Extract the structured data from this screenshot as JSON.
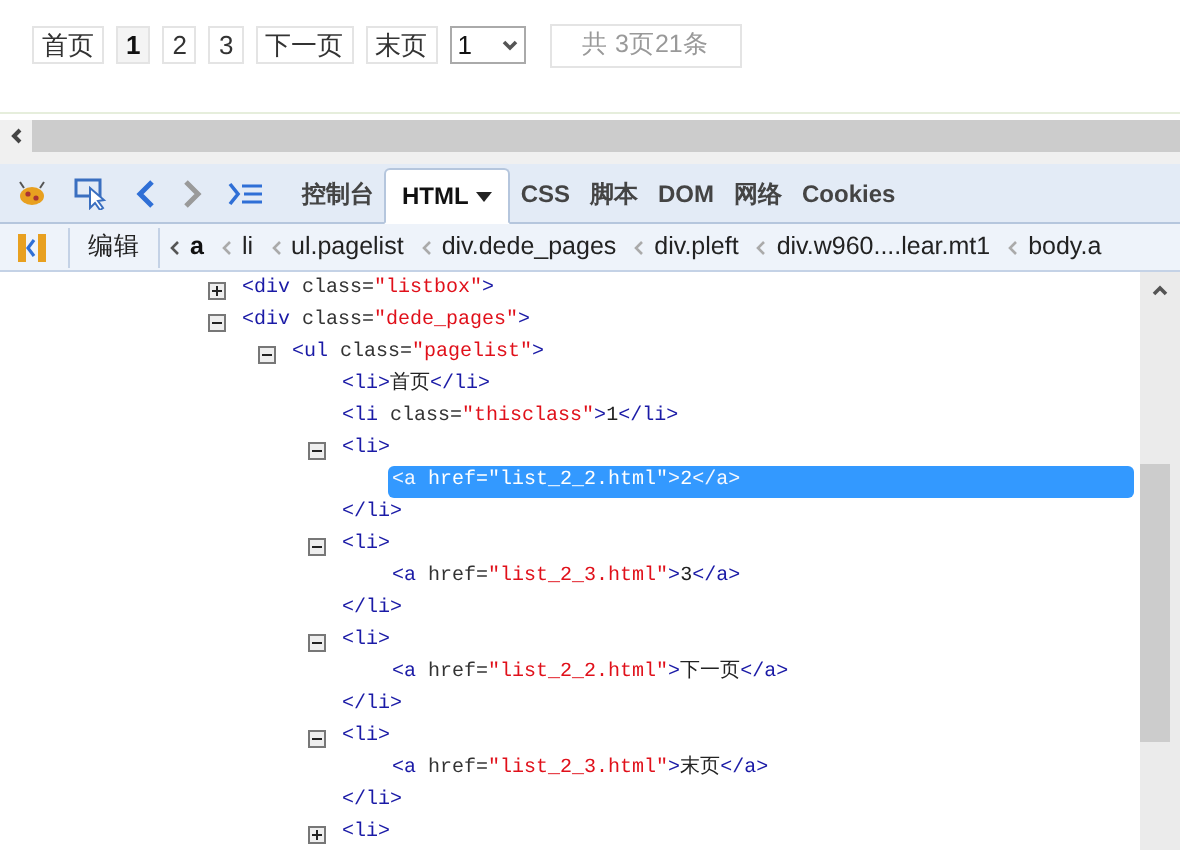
{
  "pagination": {
    "items": [
      {
        "text": "首页",
        "selected": false
      },
      {
        "text": "1",
        "selected": true
      },
      {
        "text": "2",
        "selected": false
      },
      {
        "text": "3",
        "selected": false
      },
      {
        "text": "下一页",
        "selected": false
      },
      {
        "text": "末页",
        "selected": false
      }
    ],
    "page_select": {
      "value": "1"
    },
    "summary": "共 3页21条"
  },
  "devtools": {
    "tabs": [
      {
        "label": "控制台",
        "selected": false,
        "dropdown": false
      },
      {
        "label": "HTML",
        "selected": true,
        "dropdown": true
      },
      {
        "label": "CSS",
        "selected": false,
        "dropdown": false
      },
      {
        "label": "脚本",
        "selected": false,
        "dropdown": false
      },
      {
        "label": "DOM",
        "selected": false,
        "dropdown": false
      },
      {
        "label": "网络",
        "selected": false,
        "dropdown": false
      },
      {
        "label": "Cookies",
        "selected": false,
        "dropdown": false
      }
    ],
    "edit_button": "编辑",
    "breadcrumbs": [
      {
        "label": "a",
        "selected": true
      },
      {
        "label": "li",
        "selected": false
      },
      {
        "label": "ul.pagelist",
        "selected": false
      },
      {
        "label": "div.dede_pages",
        "selected": false
      },
      {
        "label": "div.pleft",
        "selected": false
      },
      {
        "label": "div.w960....lear.mt1",
        "selected": false
      },
      {
        "label": "body.a",
        "selected": false
      }
    ],
    "tree": [
      {
        "selected": false,
        "expanded": false,
        "line": [
          {
            "kind": "tag",
            "text": "<div"
          },
          {
            "kind": "attr",
            "text": " class="
          },
          {
            "kind": "value",
            "text": "\"listbox\""
          },
          {
            "kind": "tag",
            "text": ">"
          }
        ]
      },
      {
        "selected": false,
        "expanded": true,
        "line": [
          {
            "kind": "tag",
            "text": "<div"
          },
          {
            "kind": "attr",
            "text": " class="
          },
          {
            "kind": "value",
            "text": "\"dede_pages\""
          },
          {
            "kind": "tag",
            "text": ">"
          }
        ],
        "children": [
          {
            "selected": false,
            "expanded": true,
            "line": [
              {
                "kind": "tag",
                "text": "<ul"
              },
              {
                "kind": "attr",
                "text": " class="
              },
              {
                "kind": "value",
                "text": "\"pagelist\""
              },
              {
                "kind": "tag",
                "text": ">"
              }
            ],
            "children": [
              {
                "selected": false,
                "line": [
                  {
                    "kind": "tag",
                    "text": "<li>"
                  },
                  {
                    "kind": "text",
                    "text": "首页"
                  },
                  {
                    "kind": "tag",
                    "text": "</li>"
                  }
                ]
              },
              {
                "selected": false,
                "line": [
                  {
                    "kind": "tag",
                    "text": "<li"
                  },
                  {
                    "kind": "attr",
                    "text": " class="
                  },
                  {
                    "kind": "value",
                    "text": "\"thisclass\""
                  },
                  {
                    "kind": "tag",
                    "text": ">"
                  },
                  {
                    "kind": "text",
                    "text": "1"
                  },
                  {
                    "kind": "tag",
                    "text": "</li>"
                  }
                ]
              },
              {
                "selected": false,
                "expanded": true,
                "line": [
                  {
                    "kind": "tag",
                    "text": "<li>"
                  }
                ],
                "close": [
                  {
                    "kind": "tag",
                    "text": "</li>"
                  }
                ],
                "children": [
                  {
                    "selected": true,
                    "line": [
                      {
                        "kind": "tag",
                        "text": "<a"
                      },
                      {
                        "kind": "attr",
                        "text": " href="
                      },
                      {
                        "kind": "value",
                        "text": "\"list_2_2.html\""
                      },
                      {
                        "kind": "tag",
                        "text": ">"
                      },
                      {
                        "kind": "text",
                        "text": "2"
                      },
                      {
                        "kind": "tag",
                        "text": "</a>"
                      }
                    ]
                  }
                ]
              },
              {
                "selected": false,
                "expanded": true,
                "line": [
                  {
                    "kind": "tag",
                    "text": "<li>"
                  }
                ],
                "close": [
                  {
                    "kind": "tag",
                    "text": "</li>"
                  }
                ],
                "children": [
                  {
                    "selected": false,
                    "line": [
                      {
                        "kind": "tag",
                        "text": "<a"
                      },
                      {
                        "kind": "attr",
                        "text": " href="
                      },
                      {
                        "kind": "value",
                        "text": "\"list_2_3.html\""
                      },
                      {
                        "kind": "tag",
                        "text": ">"
                      },
                      {
                        "kind": "text",
                        "text": "3"
                      },
                      {
                        "kind": "tag",
                        "text": "</a>"
                      }
                    ]
                  }
                ]
              },
              {
                "selected": false,
                "expanded": true,
                "line": [
                  {
                    "kind": "tag",
                    "text": "<li>"
                  }
                ],
                "close": [
                  {
                    "kind": "tag",
                    "text": "</li>"
                  }
                ],
                "children": [
                  {
                    "selected": false,
                    "line": [
                      {
                        "kind": "tag",
                        "text": "<a"
                      },
                      {
                        "kind": "attr",
                        "text": " href="
                      },
                      {
                        "kind": "value",
                        "text": "\"list_2_2.html\""
                      },
                      {
                        "kind": "tag",
                        "text": ">"
                      },
                      {
                        "kind": "text",
                        "text": "下一页"
                      },
                      {
                        "kind": "tag",
                        "text": "</a>"
                      }
                    ]
                  }
                ]
              },
              {
                "selected": false,
                "expanded": true,
                "line": [
                  {
                    "kind": "tag",
                    "text": "<li>"
                  }
                ],
                "close": [
                  {
                    "kind": "tag",
                    "text": "</li>"
                  }
                ],
                "children": [
                  {
                    "selected": false,
                    "line": [
                      {
                        "kind": "tag",
                        "text": "<a"
                      },
                      {
                        "kind": "attr",
                        "text": " href="
                      },
                      {
                        "kind": "value",
                        "text": "\"list_2_3.html\""
                      },
                      {
                        "kind": "tag",
                        "text": ">"
                      },
                      {
                        "kind": "text",
                        "text": "末页"
                      },
                      {
                        "kind": "tag",
                        "text": "</a>"
                      }
                    ]
                  }
                ]
              },
              {
                "selected": false,
                "expanded": false,
                "line": [
                  {
                    "kind": "tag",
                    "text": "<li>"
                  }
                ]
              }
            ]
          }
        ]
      }
    ]
  }
}
